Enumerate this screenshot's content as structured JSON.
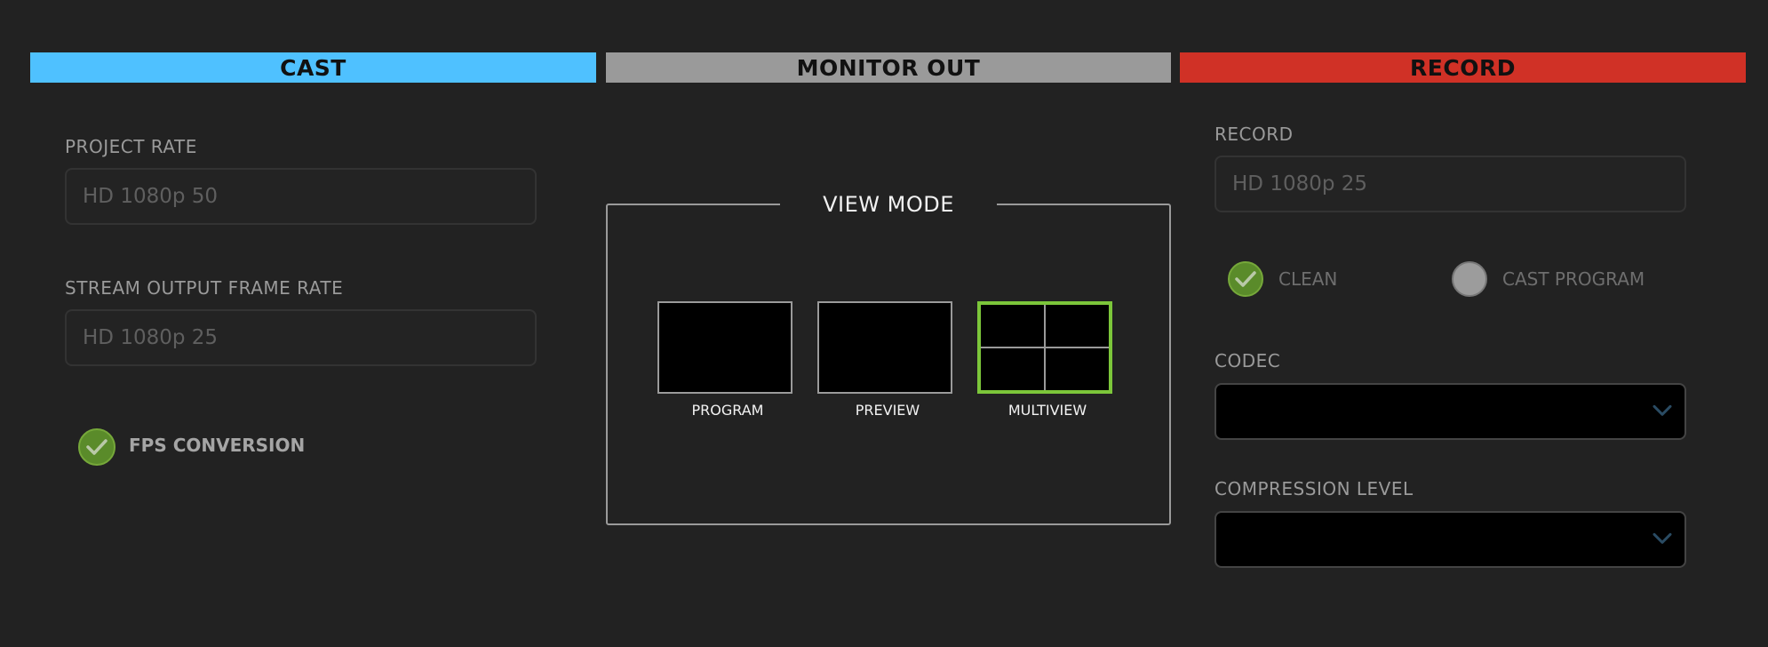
{
  "tabs": {
    "cast": "CAST",
    "monitor_out": "MONITOR OUT",
    "record": "RECORD"
  },
  "cast": {
    "project_rate_label": "PROJECT RATE",
    "project_rate_value": "HD 1080p 50",
    "stream_rate_label": "STREAM OUTPUT FRAME RATE",
    "stream_rate_value": "HD 1080p 25",
    "fps_conversion_label": "FPS CONVERSION",
    "fps_conversion_checked": true
  },
  "monitor": {
    "view_mode_title": "VIEW MODE",
    "modes": [
      "PROGRAM",
      "PREVIEW",
      "MULTIVIEW"
    ],
    "selected_mode": "MULTIVIEW"
  },
  "record": {
    "record_label": "RECORD",
    "record_value": "HD 1080p 25",
    "source_options": [
      "CLEAN",
      "CAST PROGRAM"
    ],
    "selected_source": "CLEAN",
    "codec_label": "CODEC",
    "codec_value": "",
    "compression_label": "COMPRESSION LEVEL",
    "compression_value": ""
  },
  "colors": {
    "cast_tab": "#4fc1ff",
    "monitor_tab": "#9a9a9a",
    "record_tab": "#d03126",
    "selected_green": "#7cc63a",
    "background": "#222222"
  },
  "icons": {
    "check": "check-icon",
    "chevron": "chevron-down-icon"
  }
}
